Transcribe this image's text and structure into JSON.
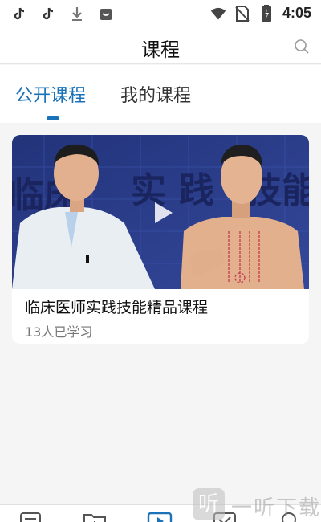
{
  "status_bar": {
    "time": "4:05",
    "left_icons": [
      "tiktok-icon",
      "tiktok-icon",
      "download-icon",
      "app-notification-icon"
    ],
    "right_icons": [
      "wifi-icon",
      "no-sim-icon",
      "battery-icon"
    ]
  },
  "header": {
    "title": "课程",
    "search_icon": "search-icon"
  },
  "tabs": [
    {
      "label": "公开课程",
      "active": true
    },
    {
      "label": "我的课程",
      "active": false
    }
  ],
  "colors": {
    "accent": "#1a73b8",
    "thumb_bg": "#2a3e8a"
  },
  "courses": [
    {
      "title": "临床医师实践技能精品课程",
      "learners": "13人已学习",
      "thumbnail_text": [
        "临床",
        "实",
        "践",
        "技能"
      ],
      "play_icon": "play-icon"
    }
  ],
  "bottom_nav": {
    "icons": [
      "list-icon",
      "folder-icon",
      "play-square-icon",
      "check-square-icon",
      "person-icon"
    ]
  },
  "watermark": {
    "logo_char": "听",
    "text": "一听下载"
  }
}
